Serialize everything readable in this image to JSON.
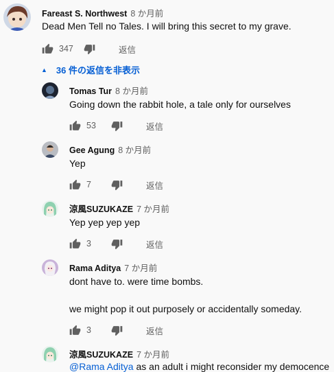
{
  "top_comment": {
    "author": "Fareast S. Northwest",
    "time": "8 か月前",
    "text": "Dead Men Tell no Tales. I will bring this secret to my grave.",
    "likes": "347",
    "reply_label": "返信"
  },
  "replies_toggle": {
    "label": "36 件の返信を非表示"
  },
  "replies": [
    {
      "author": "Tomas Tur",
      "time": "8 か月前",
      "text": "Going down the rabbit hole, a tale only for ourselves",
      "likes": "53",
      "reply_label": "返信"
    },
    {
      "author": "Gee Agung",
      "time": "8 か月前",
      "text": "Yep",
      "likes": "7",
      "reply_label": "返信"
    },
    {
      "author": "涼風SUZUKAZE",
      "time": "7 か月前",
      "text": "Yep yep yep yep",
      "likes": "3",
      "reply_label": "返信"
    },
    {
      "author": "Rama Aditya",
      "time": "7 か月前",
      "text_line1": "dont have to. were time bombs.",
      "text_line2": "we might pop it out purposely or accidentally someday.",
      "likes": "3",
      "reply_label": "返信"
    },
    {
      "author": "涼風SUZUKAZE",
      "time": "7 か月前",
      "mention": "@Rama Aditya",
      "text": " as an adult i might reconsider my democence"
    }
  ]
}
